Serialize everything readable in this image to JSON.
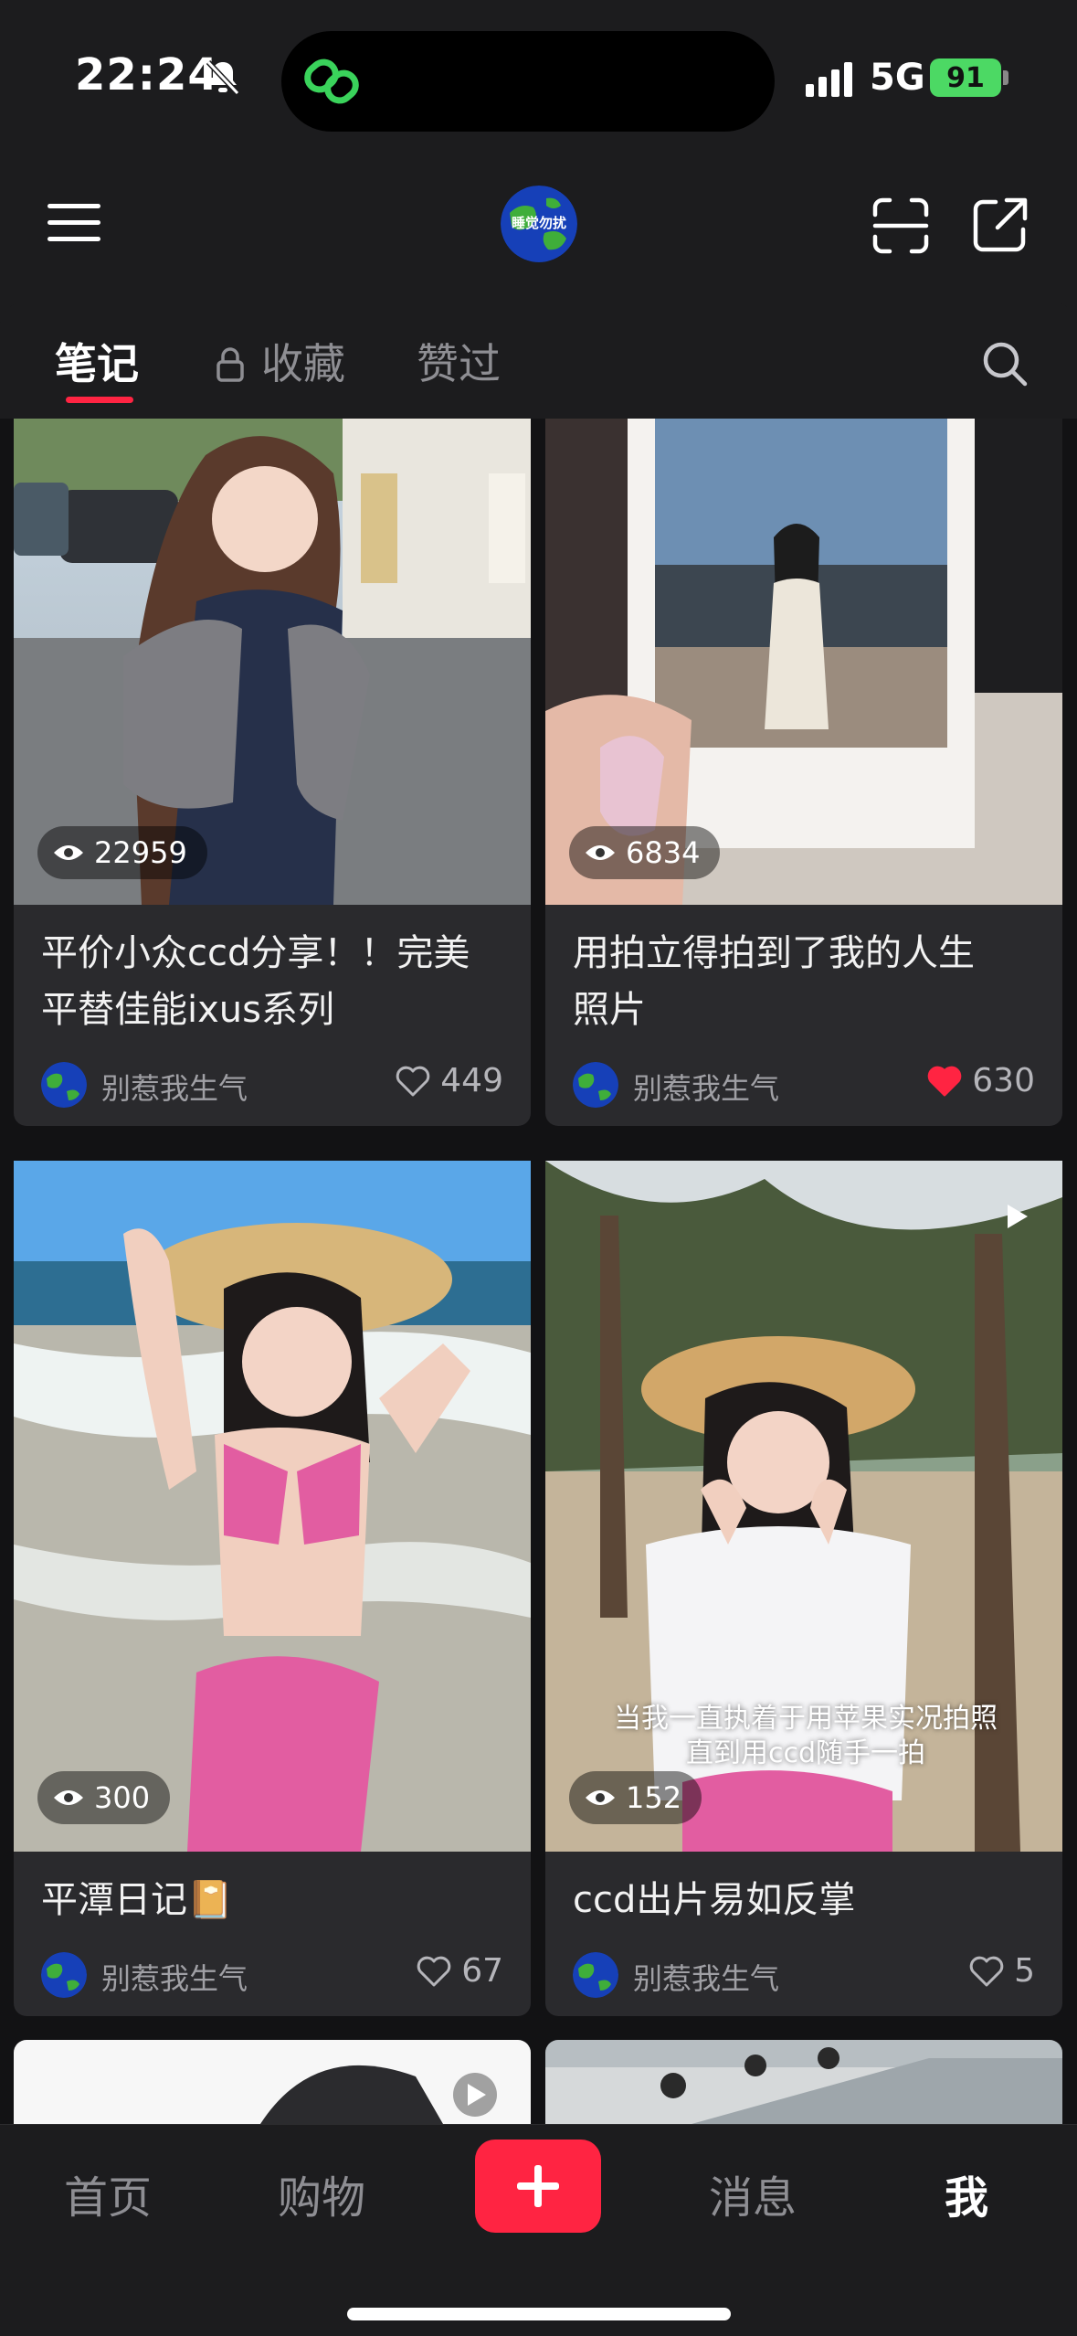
{
  "status_bar": {
    "time": "22:24",
    "network": "5G",
    "battery": "91"
  },
  "header": {
    "avatar_text": "睡觉勿扰"
  },
  "tabs": [
    {
      "label": "笔记",
      "active": true
    },
    {
      "label": "收藏",
      "active": false,
      "locked": true
    },
    {
      "label": "赞过",
      "active": false
    }
  ],
  "notes": [
    {
      "views": "22959",
      "title_line1": "平价小众ccd分享！！完美",
      "title_line2": "平替佳能ixus系列",
      "author": "别惹我生气",
      "likes": "449",
      "liked": false
    },
    {
      "views": "6834",
      "title_line1": "用拍立得拍到了我的人生",
      "title_line2": "照片",
      "author": "别惹我生气",
      "likes": "630",
      "liked": true
    },
    {
      "views": "300",
      "title_line1": "平潭日记📔",
      "author": "别惹我生气",
      "likes": "67",
      "liked": false
    },
    {
      "views": "152",
      "title_line1": "ccd出片易如反掌",
      "author": "别惹我生气",
      "likes": "5",
      "liked": false,
      "overlay_line1": "当我一直执着于用苹果实况拍照",
      "overlay_line2": "直到用ccd随手一拍"
    }
  ],
  "bottom_nav": [
    {
      "label": "首页",
      "active": false
    },
    {
      "label": "购物",
      "active": false
    },
    {
      "label": "消息",
      "active": false
    },
    {
      "label": "我",
      "active": true
    }
  ],
  "colors": {
    "accent": "#ff2442",
    "background": "#1c1c1e",
    "card": "#2a2a2d"
  }
}
